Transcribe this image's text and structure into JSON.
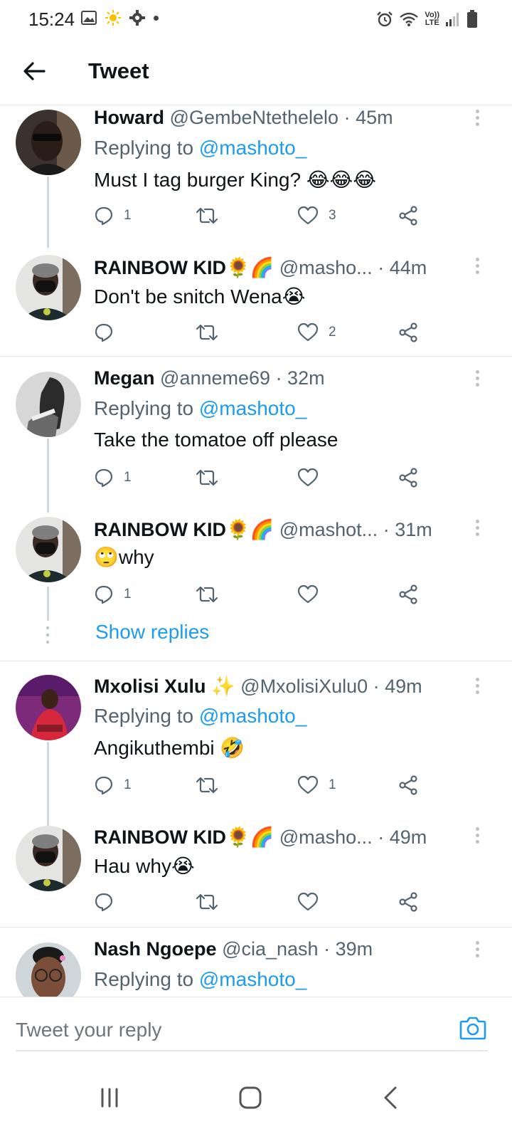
{
  "status_bar": {
    "time": "15:24",
    "left_icons": [
      "gallery-icon",
      "sun-icon",
      "gear-icon",
      "dot-icon"
    ],
    "right_icons": [
      "alarm-icon",
      "wifi-icon",
      "volte-icon",
      "signal-icon",
      "battery-icon"
    ],
    "volte_text": "Vo)) LTE"
  },
  "header": {
    "title": "Tweet",
    "back_icon": "arrow-left-icon"
  },
  "tweets": [
    {
      "name": "Howard",
      "handle": "@GembeNtethelelo",
      "time": "· 45m",
      "replying_prefix": "Replying to ",
      "replying_to": "@mashoto_",
      "text": "Must I tag burger King? 😂😂😂",
      "replies": "1",
      "retweets": "",
      "likes": "3"
    },
    {
      "name": "RAINBOW KID🌻🌈",
      "handle": "@masho...",
      "time": "· 44m",
      "text": "Don't be snitch Wena😭",
      "replies": "",
      "retweets": "",
      "likes": "2"
    },
    {
      "name": "Megan",
      "handle": "@anneme69",
      "time": "· 32m",
      "replying_prefix": "Replying to ",
      "replying_to": "@mashoto_",
      "text": "Take the tomatoe off please",
      "replies": "1",
      "retweets": "",
      "likes": ""
    },
    {
      "name": "RAINBOW KID🌻🌈",
      "handle": "@mashot...",
      "time": "· 31m",
      "text": "🙄why",
      "replies": "1",
      "retweets": "",
      "likes": ""
    },
    {
      "name": "Mxolisi Xulu ✨",
      "handle": "@MxolisiXulu0",
      "time": "· 49m",
      "replying_prefix": "Replying to ",
      "replying_to": "@mashoto_",
      "text": "Angikuthembi 🤣",
      "replies": "1",
      "retweets": "",
      "likes": "1"
    },
    {
      "name": "RAINBOW KID🌻🌈",
      "handle": "@masho...",
      "time": "· 49m",
      "text": "Hau why😭",
      "replies": "",
      "retweets": "",
      "likes": ""
    },
    {
      "name": "Nash Ngoepe",
      "handle": "@cia_nash",
      "time": "· 39m",
      "replying_prefix": "Replying to ",
      "replying_to": "@mashoto_"
    }
  ],
  "show_replies_label": "Show replies",
  "reply_bar": {
    "placeholder": "Tweet your reply",
    "camera_icon": "camera-icon"
  },
  "nav_bar": [
    "recents-icon",
    "home-icon",
    "back-icon"
  ],
  "colors": {
    "accent": "#1d9bf0",
    "text": "#0f1419",
    "muted": "#536471",
    "divider": "#e6e9eb"
  }
}
